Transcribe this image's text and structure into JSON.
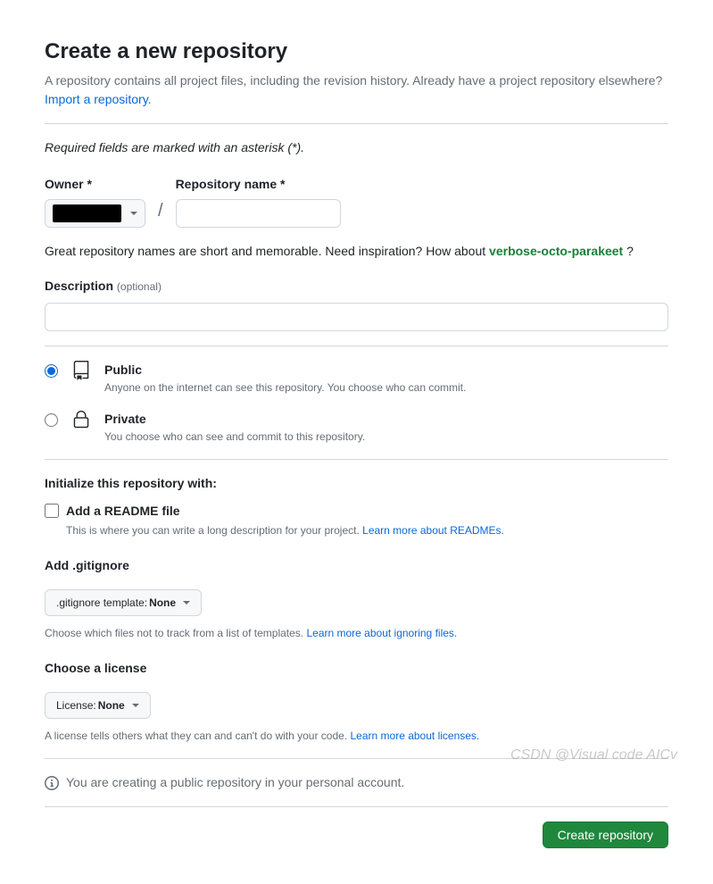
{
  "header": {
    "title": "Create a new repository",
    "subtitle": "A repository contains all project files, including the revision history. Already have a project repository elsewhere?",
    "import_link": "Import a repository."
  },
  "required_note": "Required fields are marked with an asterisk (*).",
  "owner": {
    "label": "Owner *"
  },
  "repo_name": {
    "label": "Repository name *",
    "value": ""
  },
  "hint": {
    "prefix": "Great repository names are short and memorable. Need inspiration? How about ",
    "suggestion": "verbose-octo-parakeet",
    "suffix": " ?"
  },
  "description": {
    "label": "Description",
    "optional": "(optional)",
    "value": ""
  },
  "visibility": {
    "public": {
      "title": "Public",
      "sub": "Anyone on the internet can see this repository. You choose who can commit."
    },
    "private": {
      "title": "Private",
      "sub": "You choose who can see and commit to this repository."
    }
  },
  "init": {
    "heading": "Initialize this repository with:",
    "readme": {
      "title": "Add a README file",
      "sub_prefix": "This is where you can write a long description for your project. ",
      "sub_link": "Learn more about READMEs."
    }
  },
  "gitignore": {
    "label": "Add .gitignore",
    "select_prefix": ".gitignore template: ",
    "select_value": "None",
    "helper_prefix": "Choose which files not to track from a list of templates. ",
    "helper_link": "Learn more about ignoring files."
  },
  "license": {
    "label": "Choose a license",
    "select_prefix": "License: ",
    "select_value": "None",
    "helper_prefix": "A license tells others what they can and can't do with your code. ",
    "helper_link": "Learn more about licenses."
  },
  "info_note": "You are creating a public repository in your personal account.",
  "submit": "Create repository",
  "watermark": "CSDN @Visual code AICv"
}
